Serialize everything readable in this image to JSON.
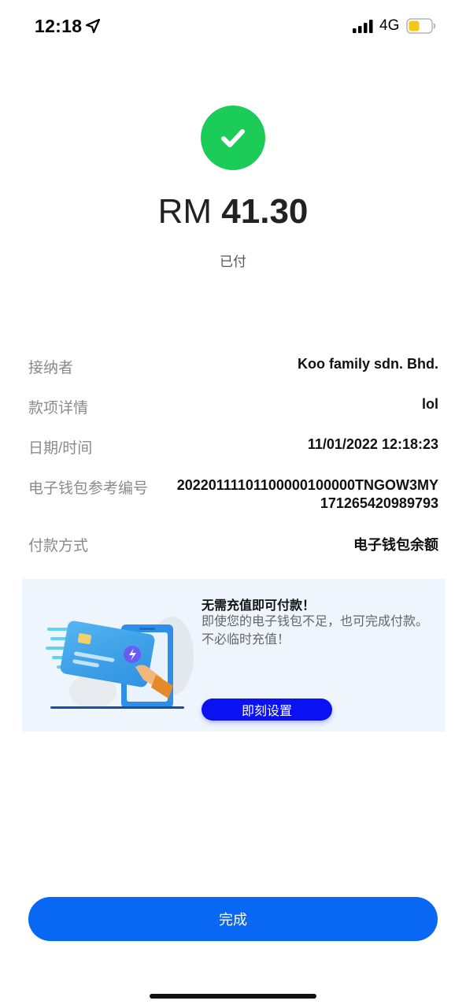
{
  "status_bar": {
    "time": "12:18",
    "network": "4G",
    "icons": [
      "location-arrow-icon",
      "signal-icon",
      "battery-icon"
    ],
    "battery_color": "#f5c518"
  },
  "header": {
    "icon": "checkmark-icon",
    "icon_color": "#1bcc58",
    "currency": "RM",
    "amount": "41.30",
    "status": "已付"
  },
  "details": {
    "recipient": {
      "label": "接纳者",
      "value": "Koo family sdn. Bhd."
    },
    "payment_details": {
      "label": "款项详情",
      "value": "lol"
    },
    "datetime": {
      "label": "日期/时间",
      "value": "11/01/2022 12:18:23"
    },
    "reference": {
      "label": "电子钱包参考编号",
      "value_line1": "20220111101100000100000TNGOW3MY",
      "value_line2": "171265420989793"
    },
    "method": {
      "label": "付款方式",
      "value": "电子钱包余额"
    }
  },
  "promo": {
    "title": "无需充值即可付款！",
    "description": "即使您的电子钱包不足，也可完成付款。不必临时充值！",
    "button_label": "即刻设置",
    "button_color": "#0a12f2",
    "illustration": "card-phone-payment-illustration"
  },
  "footer": {
    "done_label": "完成",
    "done_color": "#0868f4"
  }
}
